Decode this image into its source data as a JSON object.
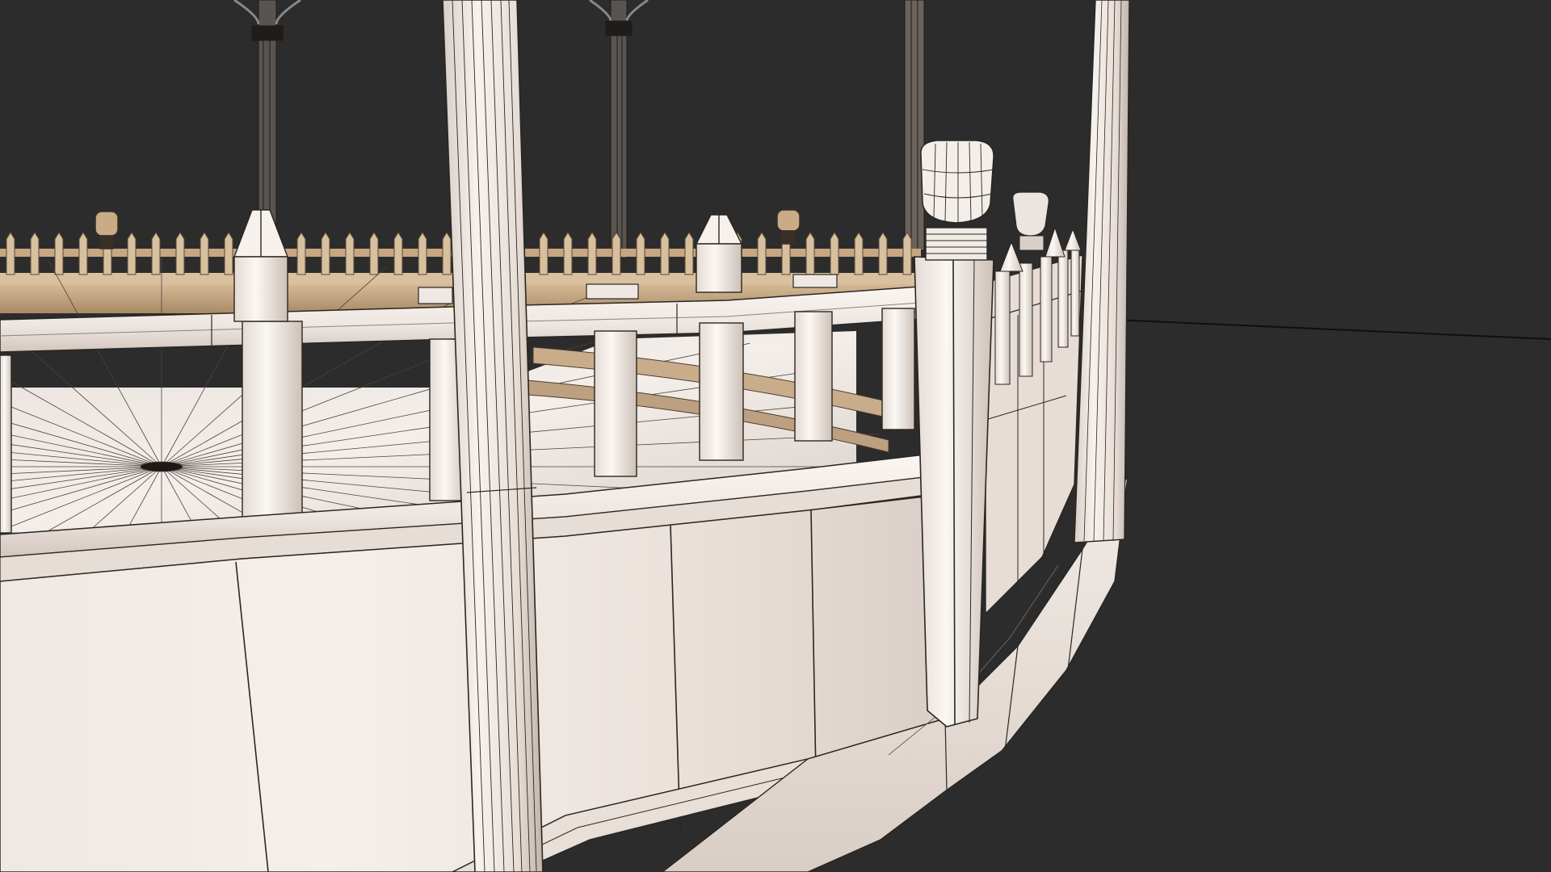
{
  "viewport": {
    "kind": "3d-wireframe-render",
    "subject": "gazebo-railing-model",
    "background_color": "#2c2c2c",
    "material_color": "#f3ece6",
    "wire_color": "#2a2622",
    "warm_interior_color": "#c7a681"
  }
}
